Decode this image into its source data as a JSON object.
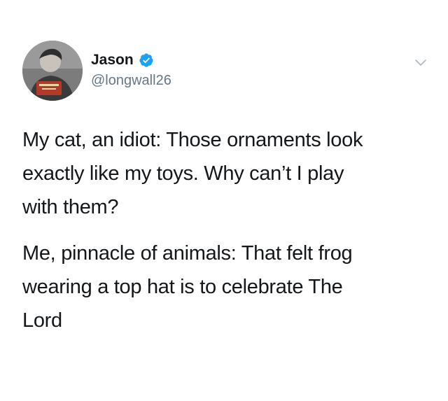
{
  "tweet": {
    "author": {
      "display_name": "Jason",
      "handle": "@longwall26",
      "verified": true,
      "avatar_icon": "avatar-photo",
      "verified_color": "#1da1f2"
    },
    "menu_icon": "chevron-down-icon",
    "paragraphs": [
      "My cat, an idiot: Those ornaments look\nexactly like my toys. Why can’t I play\nwith them?",
      "Me, pinnacle of animals: That felt frog\nwearing a top hat is to celebrate The\nLord"
    ]
  }
}
